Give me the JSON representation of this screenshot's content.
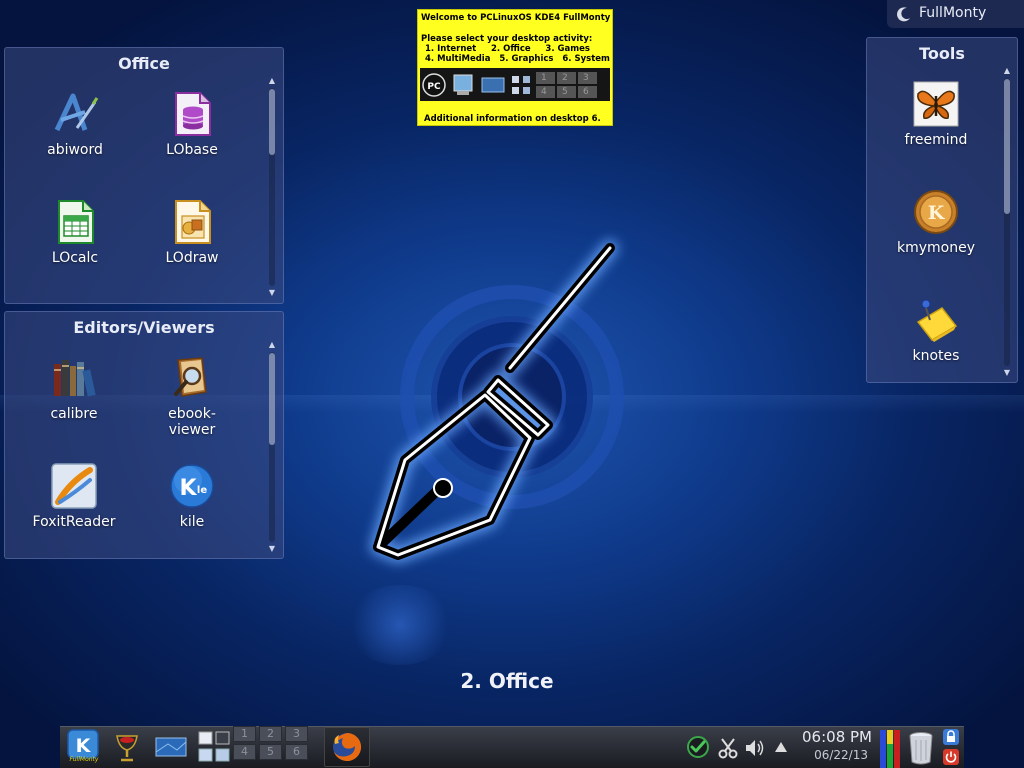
{
  "desktop": {
    "activity_name": "2. Office"
  },
  "activity_label": {
    "text": "FullMonty",
    "icon": "moon-icon"
  },
  "welcome_note": {
    "line1": "Welcome to PCLinuxOS KDE4 FullMonty",
    "line2": "Please select your desktop activity:",
    "line3": "1. Internet     2. Office     3. Games",
    "line4": "4. MultiMedia   5. Graphics   6. System",
    "line5": "Additional information on desktop 6.",
    "pager": [
      "1",
      "2",
      "3",
      "4",
      "5",
      "6"
    ]
  },
  "panels": {
    "office": {
      "title": "Office",
      "items": [
        {
          "label": "abiword",
          "icon": "abiword-icon"
        },
        {
          "label": "LObase",
          "icon": "lobase-icon"
        },
        {
          "label": "LOcalc",
          "icon": "localc-icon"
        },
        {
          "label": "LOdraw",
          "icon": "lodraw-icon"
        }
      ]
    },
    "editors": {
      "title": "Editors/Viewers",
      "items": [
        {
          "label": "calibre",
          "icon": "calibre-icon"
        },
        {
          "label": "ebook-\nviewer",
          "icon": "ebook-viewer-icon"
        },
        {
          "label": "FoxitReader",
          "icon": "foxitreader-icon"
        },
        {
          "label": "kile",
          "icon": "kile-icon"
        }
      ]
    },
    "tools": {
      "title": "Tools",
      "items": [
        {
          "label": "freemind",
          "icon": "freemind-icon"
        },
        {
          "label": "kmymoney",
          "icon": "kmymoney-icon"
        },
        {
          "label": "knotes",
          "icon": "knotes-icon"
        }
      ]
    }
  },
  "taskbar": {
    "launcher_label": "FullMonty",
    "pager": [
      "1",
      "2",
      "3",
      "4",
      "5",
      "6"
    ],
    "clock_time": "06:08 PM",
    "clock_date": "06/22/13"
  },
  "colors": {
    "desktop_blue": "#0f3a8a",
    "note_yellow": "#ffff20",
    "panel_bg": "#3c4b82",
    "taskbar_dark": "#1a1c22"
  }
}
